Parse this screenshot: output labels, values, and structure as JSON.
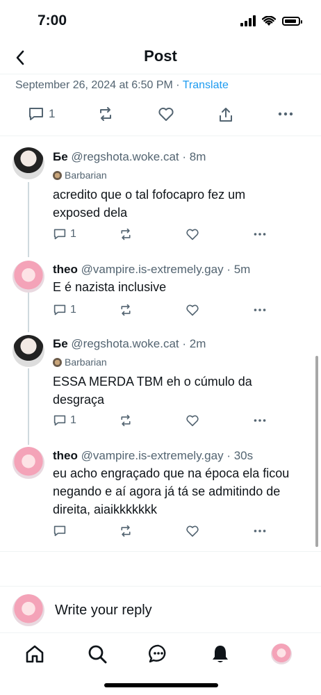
{
  "status_bar": {
    "time": "7:00"
  },
  "header": {
    "title": "Post"
  },
  "post": {
    "timestamp": "September 26, 2024 at 6:50 PM",
    "separator": "·",
    "translate": "Translate",
    "reply_count": "1"
  },
  "replies": [
    {
      "name": "Бе",
      "handle": "@regshota.woke.cat",
      "time": "8m",
      "badge": "Barbarian",
      "text": "acredito que o tal fofocapro fez um exposed dela",
      "reply_count": "1"
    },
    {
      "name": "theo",
      "handle": "@vampire.is-extremely.gay",
      "time": "5m",
      "badge": "",
      "text": "E é nazista inclusive",
      "reply_count": "1"
    },
    {
      "name": "Бе",
      "handle": "@regshota.woke.cat",
      "time": "2m",
      "badge": "Barbarian",
      "text": "ESSA MERDA TBM eh o cúmulo da desgraça",
      "reply_count": "1"
    },
    {
      "name": "theo",
      "handle": "@vampire.is-extremely.gay",
      "time": "30s",
      "badge": "",
      "text": "eu acho engraçado que na época ela ficou negando e aí agora já tá se admitindo de direita, aiaikkkkkkk",
      "reply_count": ""
    }
  ],
  "composer": {
    "placeholder": "Write your reply"
  },
  "tabs": [
    "home-icon",
    "search-icon",
    "chat-icon",
    "bell-icon",
    "profile-avatar"
  ],
  "colors": {
    "accent": "#1d9bf0",
    "muted": "#536471",
    "text": "#0f1419"
  }
}
